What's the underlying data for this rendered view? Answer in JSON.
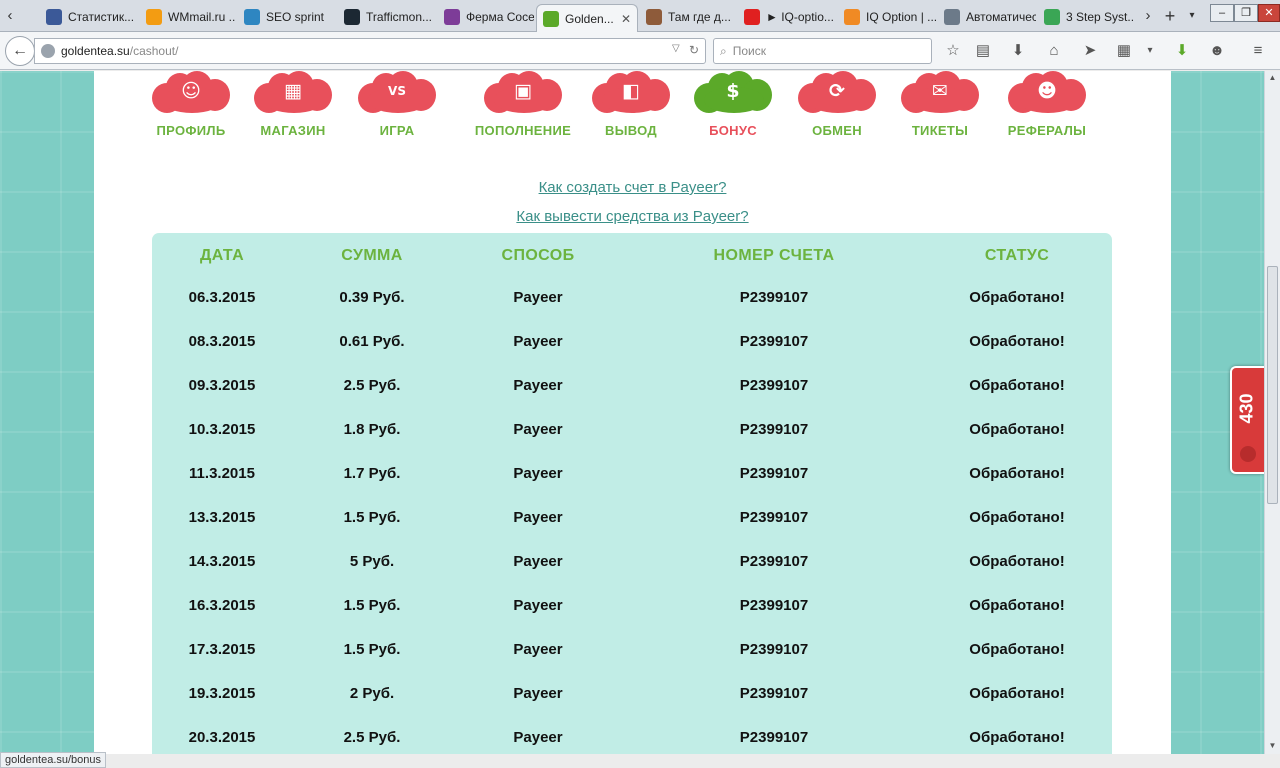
{
  "browser": {
    "tabs": [
      {
        "label": "Статистик...",
        "color": "#3b5998"
      },
      {
        "label": "WMmail.ru ...",
        "color": "#f39c12"
      },
      {
        "label": "SEO sprint",
        "color": "#2e86c1"
      },
      {
        "label": "Trafficmon...",
        "color": "#1c2833"
      },
      {
        "label": "Ферма Соседи |",
        "color": "#7d3c98"
      },
      {
        "label": "Golden...",
        "color": "#5ba929"
      },
      {
        "label": "Там где д...",
        "color": "#8e5b3a"
      },
      {
        "label": "► IQ-optio...",
        "color": "#e02020"
      },
      {
        "label": "IQ Option | ...",
        "color": "#f08a24"
      },
      {
        "label": "Автоматическ...",
        "color": "#6c7a89"
      },
      {
        "label": "3 Step Syst...",
        "color": "#3aa655"
      }
    ],
    "active_tab_index": 5,
    "url_host": "goldentea.su",
    "url_path": "/cashout/",
    "search_placeholder": "Поиск",
    "status_text": "goldentea.su/bonus"
  },
  "menu": [
    {
      "label": "ПРОФИЛЬ",
      "icon": "profile-icon",
      "glyph": "☺",
      "active": false
    },
    {
      "label": "МАГАЗИН",
      "icon": "shop-icon",
      "glyph": "▦",
      "active": false
    },
    {
      "label": "ИГРА",
      "icon": "game-vs-icon",
      "glyph": "VS",
      "active": false
    },
    {
      "label": "ПОПОЛНЕНИЕ",
      "icon": "deposit-icon",
      "glyph": "▣",
      "active": false
    },
    {
      "label": "ВЫВОД",
      "icon": "wallet-icon",
      "glyph": "◧",
      "active": false
    },
    {
      "label": "БОНУС",
      "icon": "dollar-icon",
      "glyph": "$",
      "active": true
    },
    {
      "label": "ОБМЕН",
      "icon": "exchange-icon",
      "glyph": "⟳",
      "active": false
    },
    {
      "label": "ТИКЕТЫ",
      "icon": "envelope-icon",
      "glyph": "✉",
      "active": false
    },
    {
      "label": "РЕФЕРАЛЫ",
      "icon": "referrals-icon",
      "glyph": "☻",
      "active": false
    }
  ],
  "help_links": [
    "Как создать счет в Payeer?",
    "Как вывести средства из Payeer?"
  ],
  "table": {
    "headers": [
      "ДАТА",
      "СУММА",
      "СПОСОБ",
      "НОМЕР СЧЕТА",
      "СТАТУС"
    ],
    "rows": [
      [
        "06.3.2015",
        "0.39 Руб.",
        "Payeer",
        "P2399107",
        "Обработано!"
      ],
      [
        "08.3.2015",
        "0.61 Руб.",
        "Payeer",
        "P2399107",
        "Обработано!"
      ],
      [
        "09.3.2015",
        "2.5 Руб.",
        "Payeer",
        "P2399107",
        "Обработано!"
      ],
      [
        "10.3.2015",
        "1.8 Руб.",
        "Payeer",
        "P2399107",
        "Обработано!"
      ],
      [
        "11.3.2015",
        "1.7 Руб.",
        "Payeer",
        "P2399107",
        "Обработано!"
      ],
      [
        "13.3.2015",
        "1.5 Руб.",
        "Payeer",
        "P2399107",
        "Обработано!"
      ],
      [
        "14.3.2015",
        "5 Руб.",
        "Payeer",
        "P2399107",
        "Обработано!"
      ],
      [
        "16.3.2015",
        "1.5 Руб.",
        "Payeer",
        "P2399107",
        "Обработано!"
      ],
      [
        "17.3.2015",
        "1.5 Руб.",
        "Payeer",
        "P2399107",
        "Обработано!"
      ],
      [
        "19.3.2015",
        "2 Руб.",
        "Payeer",
        "P2399107",
        "Обработано!"
      ],
      [
        "20.3.2015",
        "2.5 Руб.",
        "Payeer",
        "P2399107",
        "Обработано!"
      ]
    ]
  },
  "side_widget": {
    "count": "430"
  },
  "colors": {
    "accent_green": "#6cb33f",
    "accent_red": "#e8505b",
    "table_bg": "#c1ede6",
    "page_bg": "#7ecdc4"
  }
}
